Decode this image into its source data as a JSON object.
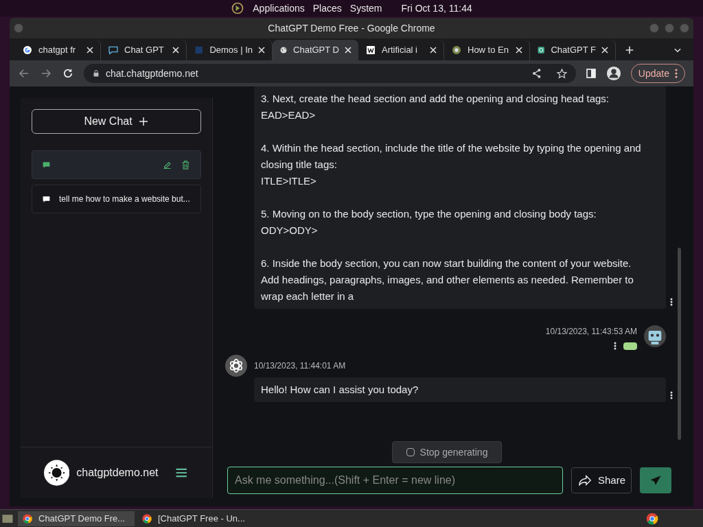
{
  "desktop_bar": {
    "menus": [
      "Applications",
      "Places",
      "System"
    ],
    "clock": "Fri Oct 13, 11:44"
  },
  "window": {
    "title": "ChatGPT Demo Free - Google Chrome"
  },
  "tabs": [
    {
      "label": "chatgpt fr",
      "selected": false
    },
    {
      "label": "Chat GPT",
      "selected": false
    },
    {
      "label": "Demos | In",
      "selected": false
    },
    {
      "label": "ChatGPT D",
      "selected": true
    },
    {
      "label": "Artificial i",
      "selected": false
    },
    {
      "label": "How to En",
      "selected": false
    },
    {
      "label": "ChatGPT F",
      "selected": false
    }
  ],
  "address_bar": {
    "url": "chat.chatgptdemo.net",
    "update_button": "Update"
  },
  "sidebar": {
    "new_chat": "New Chat",
    "chats": [
      {
        "selected": true
      },
      {
        "title": "tell me how to make a website but...",
        "selected": false
      }
    ],
    "site_name": "chatgptdemo.net"
  },
  "messages": [
    {
      "kind": "bot",
      "paragraphs": [
        "3. Next, create the head section and add the opening and closing head tags:\nEAD>EAD>",
        "4. Within the head section, include the title of the website by typing the opening and closing title tags:\nITLE>ITLE>",
        "5. Moving on to the body section, type the opening and closing body tags:\nODY>ODY>",
        "6. Inside the body section, you can now start building the content of your website. Add headings, paragraphs, images, and other elements as needed. Remember to wrap each letter in a"
      ]
    },
    {
      "kind": "user",
      "timestamp": "10/13/2023, 11:43:53 AM"
    },
    {
      "kind": "bot",
      "timestamp": "10/13/2023, 11:44:01 AM",
      "paragraphs": [
        "Hello! How can I assist you today?"
      ]
    }
  ],
  "stop_button": "Stop generating",
  "composer": {
    "placeholder": "Ask me something...(Shift + Enter = new line)",
    "share": "Share"
  },
  "taskbar": [
    "ChatGPT Demo Fre...",
    "[ChatGPT Free - Un..."
  ]
}
